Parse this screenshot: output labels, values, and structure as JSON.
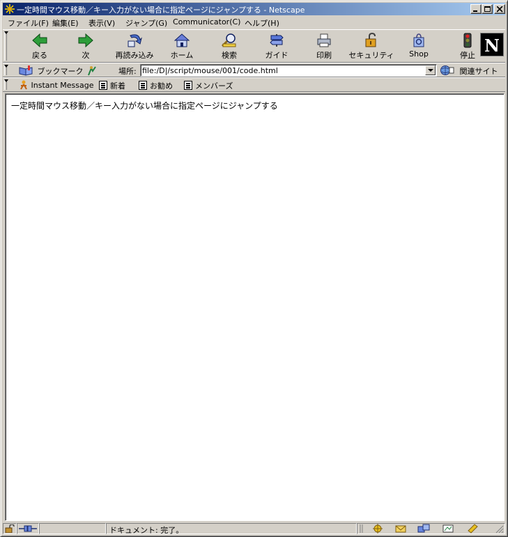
{
  "window": {
    "title": "一定時間マウス移動／キー入力がない場合に指定ページにジャンプする - Netscape"
  },
  "menu": [
    "ファイル(F)",
    "編集(E)",
    "表示(V)",
    "ジャンプ(G)",
    "Communicator(C)",
    "ヘルプ(H)"
  ],
  "nav": {
    "buttons": [
      {
        "label": "戻る",
        "icon": "back-arrow-icon"
      },
      {
        "label": "次",
        "icon": "forward-arrow-icon"
      },
      {
        "label": "再読み込み",
        "icon": "reload-icon"
      },
      {
        "label": "ホーム",
        "icon": "home-icon"
      },
      {
        "label": "検索",
        "icon": "search-icon"
      },
      {
        "label": "ガイド",
        "icon": "guide-icon"
      },
      {
        "label": "印刷",
        "icon": "print-icon"
      },
      {
        "label": "セキュリティ",
        "icon": "security-lock-icon"
      },
      {
        "label": "Shop",
        "icon": "shop-bag-icon"
      },
      {
        "label": "停止",
        "icon": "stop-icon"
      }
    ],
    "brand": "N"
  },
  "location": {
    "bookmarks_label": "ブックマーク",
    "field_label": "場所:",
    "url": "file:/D|/script/mouse/001/code.html",
    "related_label": "関連サイト"
  },
  "personal": {
    "items": [
      "Instant Message",
      "新着",
      "お勧め",
      "メンバーズ"
    ]
  },
  "content": {
    "text": "一定時間マウス移動／キー入力がない場合に指定ページにジャンプする"
  },
  "status": {
    "text": "ドキュメント: 完了。"
  }
}
